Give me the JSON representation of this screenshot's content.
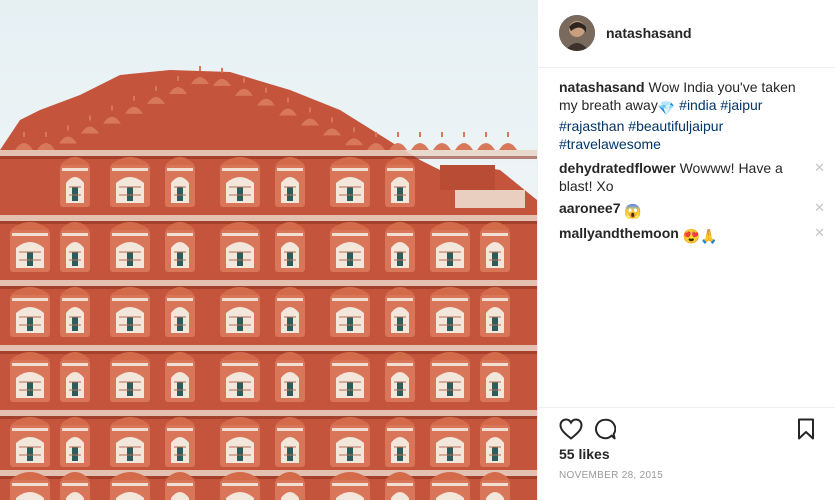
{
  "post": {
    "author": "natashasand",
    "image_subject": "Hawa Mahal palace facade, Jaipur",
    "caption": {
      "user": "natashasand",
      "text_before": "Wow India you've taken my breath away",
      "emoji_after_text": "💎",
      "hashtags": [
        "#india",
        "#jaipur",
        "#rajasthan",
        "#beautifuljaipur",
        "#travelawesome"
      ]
    },
    "comments": [
      {
        "user": "dehydratedflower",
        "text": "Wowww! Have a blast! Xo",
        "close": "✕"
      },
      {
        "user": "aaronee7",
        "text": "😱",
        "close": "✕"
      },
      {
        "user": "mallyandthemoon",
        "text": "😍🙏",
        "close": "✕"
      }
    ],
    "likes": "55 likes",
    "date": "NOVEMBER 28, 2015"
  },
  "icons": {
    "like": "heart-outline-icon",
    "comment": "speech-bubble-icon",
    "save": "bookmark-icon"
  },
  "colors": {
    "hashtag": "#003569",
    "text": "#262626",
    "muted": "#999999",
    "facade": "#c8553a"
  }
}
